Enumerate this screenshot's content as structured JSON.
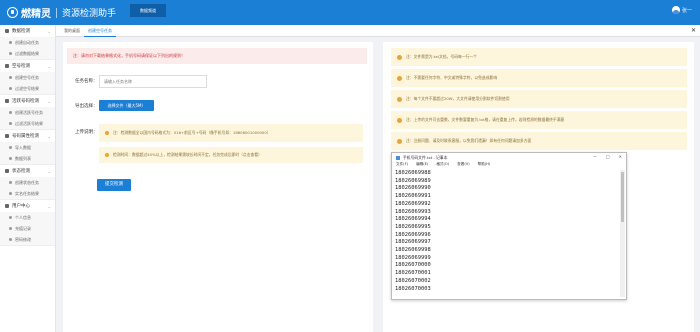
{
  "app": {
    "name": "燃精灵",
    "subtitle": "资源检测助手",
    "top_tab": "数据频道",
    "user_name": "张一"
  },
  "sidebar": [
    {
      "group": "数据检测",
      "items": [
        "创建自动任务",
        "过滤数据结果"
      ]
    },
    {
      "group": "空号检测",
      "items": [
        "创建空号任务",
        "过滤空号结果"
      ]
    },
    {
      "group": "活跃号码检测",
      "items": [
        "创建活跃号任务",
        "过滤活跃号结果"
      ]
    },
    {
      "group": "号码属性检测",
      "items": [
        "导入数据",
        "数据列表"
      ]
    },
    {
      "group": "状态检测",
      "items": [
        "创建状态任务",
        "实名任务结果"
      ]
    },
    {
      "group": "用户中心",
      "items": [
        "个人信息",
        "充值记录",
        "密码修改"
      ]
    }
  ],
  "subtabs": [
    "我的桌面",
    "创建空号任务"
  ],
  "form": {
    "alert": "注：请勿对下载结果格式化，手机号码请保证以下列出的规则！",
    "task_name_label": "任务名称：",
    "task_name_placeholder": "请输入任务名称",
    "upload_label": "导出选择：",
    "upload_button": "选择文件（最大5M）",
    "tips_label": "上传说明：",
    "tip1": "注：检测数据全以国内号码格式为：016+前区号+号码（像手机号如：18806001000000）",
    "tip2": "检测时间：数据超过40%以上，检测结果需较长时间不定，任务完成后即时（点击查看）",
    "submit_button": "提交检测"
  },
  "notes": [
    "注：文件需是为.txt文档，号码每一行一个",
    "注：不需要任何字符、中文或特殊字符，以免造成影响",
    "注：每个文件不要超过20W，大文件请使用分割软件切割使用",
    "注：上传的文件可去重数，文件数要重复为.txt格，请在重复上传，若则检测的数据最终不满意",
    "注：注册问题、请及时联系客服，以免我们遗漏！如有任何问题请加多方面"
  ],
  "notepad": {
    "title": "手机号码文件.txt - 记事本",
    "controls": [
      "—",
      "□",
      "✕"
    ],
    "menu": [
      "文件(F)",
      "编辑(E)",
      "格式(O)",
      "查看(V)",
      "帮助(H)"
    ],
    "lines": [
      "18026069988",
      "18026069989",
      "18026069990",
      "18026069991",
      "18026069992",
      "18026069993",
      "18026069994",
      "18026069995",
      "18026069996",
      "18026069997",
      "18026069998",
      "18026069999",
      "18026070000",
      "18026070001",
      "18026070002",
      "18026070003"
    ]
  }
}
